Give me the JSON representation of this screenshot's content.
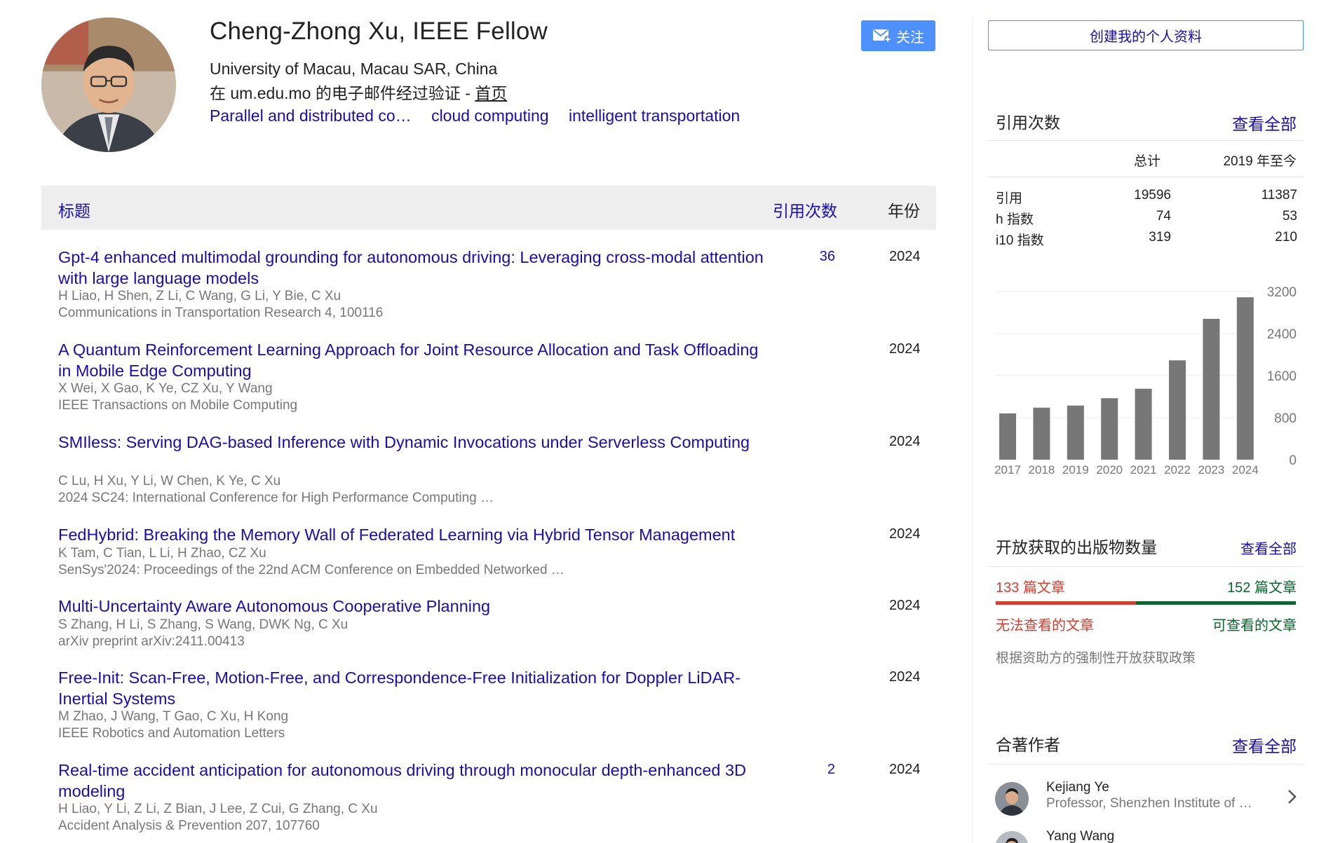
{
  "profile": {
    "name": "Cheng-Zhong Xu, IEEE Fellow",
    "affiliation": "University of Macau, Macau SAR, China",
    "verified_prefix": "在 um.edu.mo 的电子邮件经过验证 - ",
    "homepage_label": "首页",
    "interests": [
      "Parallel and distributed co…",
      "cloud computing",
      "intelligent transportation"
    ],
    "follow_label": "关注"
  },
  "articles": {
    "headers": {
      "title": "标题",
      "cited_by": "引用次数",
      "year": "年份"
    },
    "rows": [
      {
        "title": "Gpt-4 enhanced multimodal grounding for autonomous driving: Leveraging cross-modal attention with large language models",
        "authors": "H Liao, H Shen, Z Li, C Wang, G Li, Y Bie, C Xu",
        "venue": "Communications in Transportation Research 4, 100116",
        "cited_by": "36",
        "year": "2024"
      },
      {
        "title": "A Quantum Reinforcement Learning Approach for Joint Resource Allocation and Task Offloading in Mobile Edge Computing",
        "authors": "X Wei, X Gao, K Ye, CZ Xu, Y Wang",
        "venue": "IEEE Transactions on Mobile Computing",
        "cited_by": "",
        "year": "2024"
      },
      {
        "title": "SMIless: Serving DAG-based Inference with Dynamic Invocations under Serverless Computing",
        "authors": "C Lu, H Xu, Y Li, W Chen, K Ye, C Xu",
        "venue": "2024 SC24: International Conference for High Performance Computing …",
        "cited_by": "",
        "year": "2024"
      },
      {
        "title": "FedHybrid: Breaking the Memory Wall of Federated Learning via Hybrid Tensor Management",
        "authors": "K Tam, C Tian, L Li, H Zhao, CZ Xu",
        "venue": "SenSys'2024: Proceedings of the 22nd ACM Conference on Embedded Networked …",
        "cited_by": "",
        "year": "2024"
      },
      {
        "title": "Multi-Uncertainty Aware Autonomous Cooperative Planning",
        "authors": "S Zhang, H Li, S Zhang, S Wang, DWK Ng, C Xu",
        "venue": "arXiv preprint arXiv:2411.00413",
        "cited_by": "",
        "year": "2024"
      },
      {
        "title": "Free-Init: Scan-Free, Motion-Free, and Correspondence-Free Initialization for Doppler LiDAR-Inertial Systems",
        "authors": "M Zhao, J Wang, T Gao, C Xu, H Kong",
        "venue": "IEEE Robotics and Automation Letters",
        "cited_by": "",
        "year": "2024"
      },
      {
        "title": "Real-time accident anticipation for autonomous driving through monocular depth-enhanced 3D modeling",
        "authors": "H Liao, Y Li, Z Li, Z Bian, J Lee, Z Cui, G Zhang, C Xu",
        "venue": "Accident Analysis & Prevention 207, 107760",
        "cited_by": "2",
        "year": "2024"
      }
    ]
  },
  "sidebar": {
    "create_profile_label": "创建我的个人资料",
    "citations": {
      "title": "引用次数",
      "view_all": "查看全部",
      "col_total": "总计",
      "col_since": "2019 年至今",
      "rows": [
        {
          "label": "引用",
          "total": "19596",
          "since": "11387"
        },
        {
          "label": "h 指数",
          "total": "74",
          "since": "53"
        },
        {
          "label": "i10 指数",
          "total": "319",
          "since": "210"
        }
      ]
    },
    "open_access": {
      "title": "开放获取的出版物数量",
      "view_all": "查看全部",
      "unavailable_count": "133 篇文章",
      "available_count": "152 篇文章",
      "unavailable_label": "无法查看的文章",
      "available_label": "可查看的文章",
      "unavailable_fraction": 0.467,
      "note": "根据资助方的强制性开放获取政策"
    },
    "coauthors": {
      "title": "合著作者",
      "view_all": "查看全部",
      "items": [
        {
          "name": "Kejiang Ye",
          "desc": "Professor, Shenzhen Institute of …"
        },
        {
          "name": "Yang Wang",
          "desc": ""
        }
      ]
    }
  },
  "chart_data": {
    "type": "bar",
    "categories": [
      "2017",
      "2018",
      "2019",
      "2020",
      "2021",
      "2022",
      "2023",
      "2024"
    ],
    "values": [
      880,
      990,
      1030,
      1170,
      1350,
      1890,
      2680,
      3090
    ],
    "ylim": [
      0,
      3200
    ],
    "y_ticks": [
      "0",
      "800",
      "1600",
      "2400",
      "3200"
    ],
    "bar_color": "#777777",
    "grid": true
  },
  "colors": {
    "link": "#1a0dab",
    "accent_button": "#4d90fe",
    "oa_red": "#d23f31",
    "oa_green": "#0d652d"
  }
}
